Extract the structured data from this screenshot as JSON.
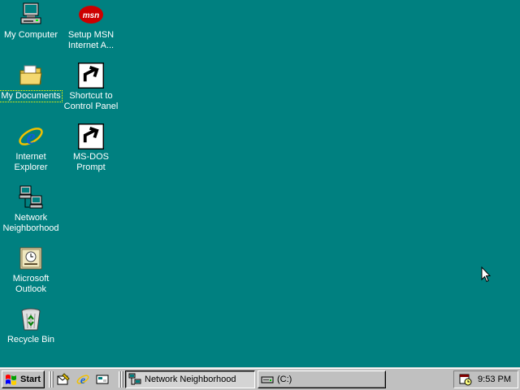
{
  "desktop": {
    "background_color": "#008080",
    "icons": [
      {
        "label": "My Computer",
        "icon": "computer-icon"
      },
      {
        "label": "Setup MSN Internet A...",
        "icon": "msn-icon"
      },
      {
        "label": "My Documents",
        "icon": "folder-icon"
      },
      {
        "label": "Shortcut to Control Panel",
        "icon": "control-panel-icon"
      },
      {
        "label": "Internet Explorer",
        "icon": "ie-icon"
      },
      {
        "label": "MS-DOS Prompt",
        "icon": "msdos-icon"
      },
      {
        "label": "Network Neighborhood",
        "icon": "network-icon"
      },
      {
        "label": "Microsoft Outlook",
        "icon": "outlook-icon"
      },
      {
        "label": "Recycle Bin",
        "icon": "recycle-bin-icon"
      }
    ],
    "labels": {
      "my_computer": "My Computer",
      "msn_1": "Setup MSN",
      "msn_2": "Internet A...",
      "my_documents": "My Documents",
      "cp_1": "Shortcut to",
      "cp_2": "Control Panel",
      "ie_1": "Internet",
      "ie_2": "Explorer",
      "dos_1": "MS-DOS",
      "dos_2": "Prompt",
      "net_1": "Network",
      "net_2": "Neighborhood",
      "out_1": "Microsoft",
      "out_2": "Outlook",
      "recycle": "Recycle Bin"
    }
  },
  "taskbar": {
    "start_label": "Start",
    "quick_launch": [
      "outlook-express-icon",
      "ie-icon",
      "show-desktop-icon"
    ],
    "tasks": [
      {
        "label": "Network Neighborhood",
        "icon": "network-icon",
        "active": true
      },
      {
        "label": "(C:)",
        "icon": "drive-icon",
        "active": false
      }
    ],
    "task_labels": {
      "network": "Network Neighborhood",
      "drive": "(C:)"
    },
    "tray": {
      "clock": "9:53 PM",
      "icon": "scheduler-icon"
    }
  }
}
